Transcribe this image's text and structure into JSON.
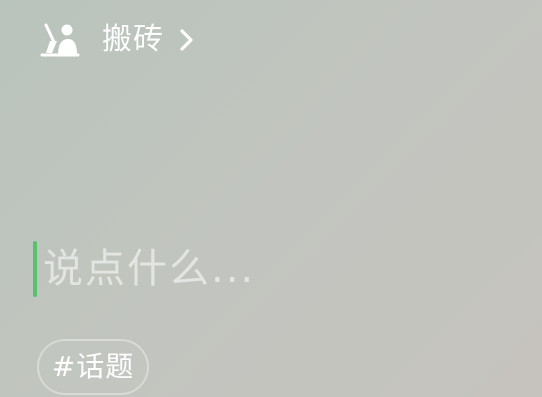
{
  "status": {
    "icon": "worker-with-broom-icon",
    "label": "搬砖",
    "chevron": "chevron-right-icon"
  },
  "compose": {
    "placeholder": "说点什么..."
  },
  "topic": {
    "label": "#话题"
  },
  "colors": {
    "caret": "#57c26a",
    "text_primary": "#ffffff"
  }
}
